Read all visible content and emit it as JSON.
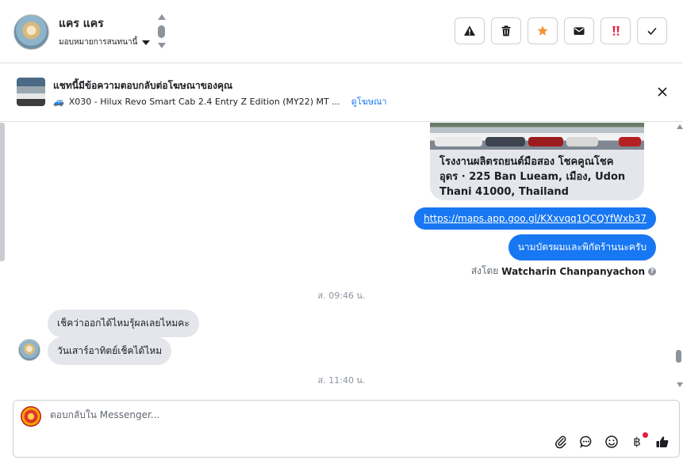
{
  "header": {
    "name": "แคร แคร",
    "assign_label": "มอบหมายการสนทนานี้",
    "actions": [
      {
        "name": "spam-button",
        "icon": "warning-icon"
      },
      {
        "name": "delete-button",
        "icon": "trash-icon"
      },
      {
        "name": "star-button",
        "icon": "star-icon"
      },
      {
        "name": "mark-unread-button",
        "icon": "envelope-icon"
      },
      {
        "name": "follow-up-button",
        "icon": "exclamation-icon"
      },
      {
        "name": "mark-done-button",
        "icon": "check-icon"
      }
    ]
  },
  "ad_bar": {
    "title": "แชทนี้มีข้อความตอบกลับต่อโฆษณาของคุณ",
    "car_emoji": "🚙",
    "ad_text": "X030 - Hilux Revo Smart Cab 2.4 Entry Z Edition (MY22) MT ...",
    "link": "ดูโฆษณา"
  },
  "messages": {
    "place_card": "โรงงานผลิตรถยนต์มือสอง โชคคูณโชค อุดร · 225 Ban Lueam, เมือง, Udon Thani 41000, Thailand",
    "link_message": "https://maps.app.goo.gl/KXxvqq1QCQYfWxb37",
    "out_message": "นามบัตรผมและพิกัดร้านนะครับ",
    "sent_by_label": "ส่งโดย",
    "sent_by_name": "Watcharin Chanpanyachon",
    "time_1": "ส. 09:46 น.",
    "in_message_1": "เช็คว่าออกได้ไหมรุ้ผลเลยไหมคะ",
    "in_message_2": "วันเสาร์อาทิตย์เช็คได้ไหม",
    "time_2": "ส. 11:40 น."
  },
  "reply": {
    "placeholder": "ตอบกลับใน Messenger...",
    "tools": [
      "paperclip-icon",
      "chat-bubble-icon",
      "emoji-icon",
      "baht-icon",
      "thumbs-up-icon"
    ],
    "baht_symbol": "฿"
  },
  "colors": {
    "accent": "#1877f2",
    "star": "#f7923a",
    "alert_red": "#e41e3f",
    "bubble_in": "#e4e6eb"
  }
}
